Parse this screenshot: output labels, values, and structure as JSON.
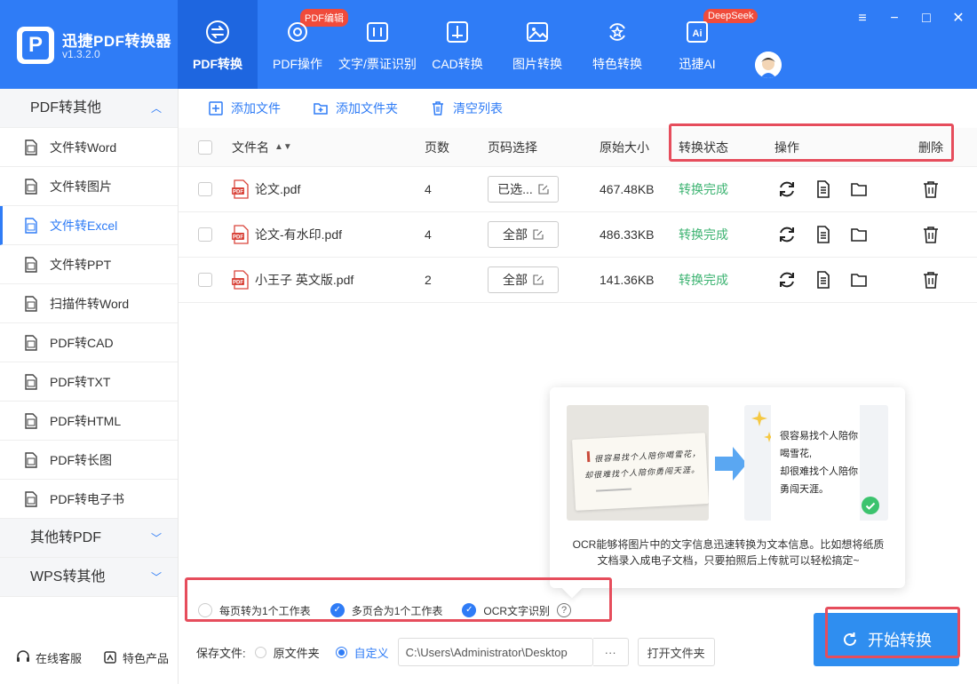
{
  "app": {
    "title": "迅捷PDF转换器",
    "version": "v1.3.2.0"
  },
  "nav": [
    {
      "label": "PDF转换",
      "active": true,
      "badge": ""
    },
    {
      "label": "PDF操作",
      "active": false,
      "badge": "PDF编辑"
    },
    {
      "label": "文字/票证识别",
      "active": false,
      "badge": ""
    },
    {
      "label": "CAD转换",
      "active": false,
      "badge": ""
    },
    {
      "label": "图片转换",
      "active": false,
      "badge": ""
    },
    {
      "label": "特色转换",
      "active": false,
      "badge": ""
    },
    {
      "label": "迅捷AI",
      "active": false,
      "badge": "DeepSeek"
    }
  ],
  "sidebar": {
    "group1": "PDF转其他",
    "items": [
      {
        "label": "文件转Word",
        "icon": "word-doc-icon"
      },
      {
        "label": "文件转图片",
        "icon": "image-icon"
      },
      {
        "label": "文件转Excel",
        "icon": "excel-doc-icon",
        "active": true
      },
      {
        "label": "文件转PPT",
        "icon": "ppt-doc-icon"
      },
      {
        "label": "扫描件转Word",
        "icon": "scan-word-icon"
      },
      {
        "label": "PDF转CAD",
        "icon": "cad-doc-icon"
      },
      {
        "label": "PDF转TXT",
        "icon": "txt-doc-icon"
      },
      {
        "label": "PDF转HTML",
        "icon": "html-doc-icon"
      },
      {
        "label": "PDF转长图",
        "icon": "long-image-icon"
      },
      {
        "label": "PDF转电子书",
        "icon": "ebook-icon"
      }
    ],
    "group2": "其他转PDF",
    "group3": "WPS转其他",
    "online_service": "在线客服",
    "featured": "特色产品"
  },
  "toolbar": {
    "add_file": "添加文件",
    "add_folder": "添加文件夹",
    "clear_list": "清空列表"
  },
  "table": {
    "headers": {
      "filename": "文件名",
      "pages": "页数",
      "page_select": "页码选择",
      "size": "原始大小",
      "status": "转换状态",
      "actions": "操作",
      "delete": "删除"
    },
    "rows": [
      {
        "name": "论文.pdf",
        "pages": "4",
        "page_select": "已选...",
        "size": "467.48KB",
        "status": "转换完成"
      },
      {
        "name": "论文-有水印.pdf",
        "pages": "4",
        "page_select": "全部",
        "size": "486.33KB",
        "status": "转换完成"
      },
      {
        "name": "小王子 英文版.pdf",
        "pages": "2",
        "page_select": "全部",
        "size": "141.36KB",
        "status": "转换完成"
      }
    ]
  },
  "ocr_popup": {
    "handwriting_line1": "很容易找个人陪你喝雪花，",
    "handwriting_line2": "却很难找个人陪你勇闯天涯。",
    "result_lines": [
      "很容易找个人陪你",
      "喝雪花,",
      "却很难找个人陪你",
      "勇闯天涯。"
    ],
    "description": "OCR能够将图片中的文字信息迅速转换为文本信息。比如想将纸质文档录入成电子文档，只要拍照后上传就可以轻松搞定~"
  },
  "options": {
    "per_page_sheet": "每页转为1个工作表",
    "multi_page_sheet": "多页合为1个工作表",
    "ocr": "OCR文字识别",
    "help": "?"
  },
  "save": {
    "label": "保存文件:",
    "original_folder": "原文件夹",
    "custom": "自定义",
    "path": "C:\\Users\\Administrator\\Desktop",
    "browse": "···",
    "open_folder": "打开文件夹"
  },
  "start_button": "开始转换",
  "colors": {
    "primary": "#2f7cf6",
    "success": "#3cb371",
    "highlight": "#e64d5c",
    "badge": "#f04b3b"
  }
}
